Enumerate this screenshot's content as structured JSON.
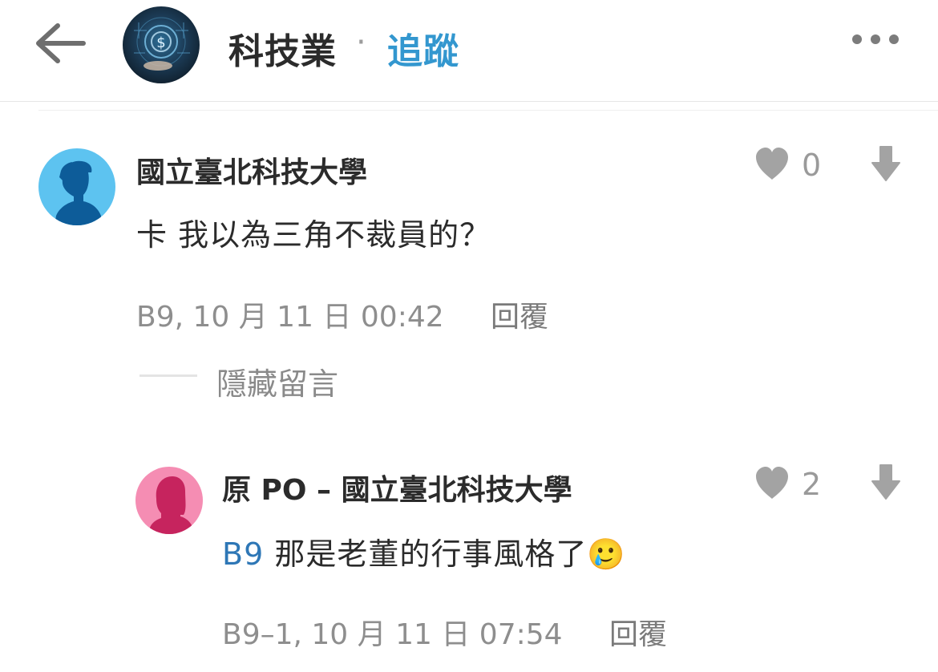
{
  "header": {
    "board_name": "科技業",
    "separator": "·",
    "follow_label": "追蹤"
  },
  "comments": [
    {
      "author": "國立臺北科技大學",
      "body": "卡 我以為三角不裁員的？",
      "likes": "0",
      "meta": "B9, 10 月 11 日 00:42",
      "reply_label": "回覆",
      "avatar_color": "#5dc3f0",
      "hide_label": "隱藏留言"
    },
    {
      "author": "原 PO – 國立臺北科技大學",
      "mention": "B9",
      "body": "那是老董的行事風格了",
      "emoji": "🥲",
      "likes": "2",
      "meta": "B9–1, 10 月 11 日 07:54",
      "reply_label": "回覆",
      "avatar_color": "#f58db3"
    }
  ],
  "colors": {
    "accent": "#3397cf",
    "mention": "#2e77b6",
    "muted": "#8e8e8e",
    "icon_gray": "#9a9a9a"
  },
  "icons": [
    "back-arrow-icon",
    "more-icon",
    "heart-icon",
    "download-arrow-icon",
    "male-avatar-icon",
    "female-avatar-icon"
  ]
}
